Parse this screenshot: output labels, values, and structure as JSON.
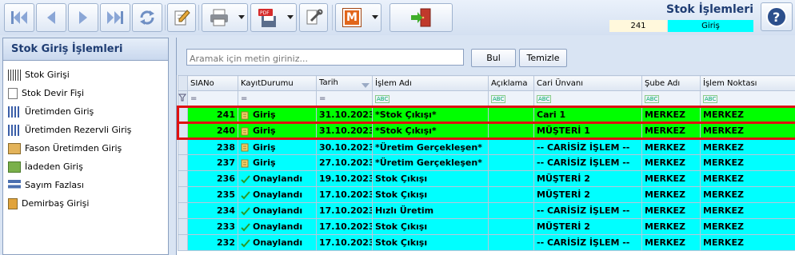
{
  "header": {
    "title": "Stok İşlemleri",
    "record_id": "241",
    "record_type": "Giriş"
  },
  "sidebar": {
    "title": "Stok Giriş İşlemleri",
    "items": [
      {
        "label": "Stok Girişi"
      },
      {
        "label": "Stok Devir Fişi"
      },
      {
        "label": "Üretimden Giriş"
      },
      {
        "label": "Üretimden Rezervli Giriş"
      },
      {
        "label": "Fason Üretimden Giriş"
      },
      {
        "label": "İadeden Giriş"
      },
      {
        "label": "Sayım Fazlası"
      },
      {
        "label": "Demirbaş Girişi"
      }
    ]
  },
  "search": {
    "placeholder": "Aramak için metin giriniz...",
    "find_label": "Bul",
    "clear_label": "Temizle"
  },
  "grid": {
    "columns": [
      "SIANo",
      "KayıtDurumu",
      "Tarih",
      "İşlem Adı",
      "Açıklama",
      "Cari Ünvanı",
      "Şube Adı",
      "İşlem Noktası"
    ],
    "filter_eq": "=",
    "filter_abc": "ABC",
    "rows": [
      {
        "no": "241",
        "status": "Giriş",
        "date": "31.10.2023",
        "op": "*Stok Çıkışı*",
        "desc": "",
        "cari": "Cari 1",
        "branch": "MERKEZ",
        "point": "MERKEZ"
      },
      {
        "no": "240",
        "status": "Giriş",
        "date": "31.10.2023",
        "op": "*Stok Çıkışı*",
        "desc": "",
        "cari": "MÜŞTERİ 1",
        "branch": "MERKEZ",
        "point": "MERKEZ"
      },
      {
        "no": "238",
        "status": "Giriş",
        "date": "30.10.2023",
        "op": "*Üretim Gerçekleşen*",
        "desc": "",
        "cari": "-- CARİSİZ İŞLEM --",
        "branch": "MERKEZ",
        "point": "MERKEZ"
      },
      {
        "no": "237",
        "status": "Giriş",
        "date": "27.10.2023",
        "op": "*Üretim Gerçekleşen*",
        "desc": "",
        "cari": "-- CARİSİZ İŞLEM --",
        "branch": "MERKEZ",
        "point": "MERKEZ"
      },
      {
        "no": "236",
        "status": "Onaylandı",
        "date": "19.10.2023",
        "op": "Stok Çıkışı",
        "desc": "",
        "cari": "MÜŞTERİ 2",
        "branch": "MERKEZ",
        "point": "MERKEZ"
      },
      {
        "no": "235",
        "status": "Onaylandı",
        "date": "17.10.2023",
        "op": "Stok Çıkışı",
        "desc": "",
        "cari": "MÜŞTERİ 2",
        "branch": "MERKEZ",
        "point": "MERKEZ"
      },
      {
        "no": "234",
        "status": "Onaylandı",
        "date": "17.10.2023",
        "op": "Hızlı Üretim",
        "desc": "",
        "cari": "-- CARİSİZ İŞLEM --",
        "branch": "MERKEZ",
        "point": "MERKEZ"
      },
      {
        "no": "233",
        "status": "Onaylandı",
        "date": "17.10.2023",
        "op": "Stok Çıkışı",
        "desc": "",
        "cari": "MÜŞTERİ 2",
        "branch": "MERKEZ",
        "point": "MERKEZ"
      },
      {
        "no": "232",
        "status": "Onaylandı",
        "date": "17.10.2023",
        "op": "Stok Çıkışı",
        "desc": "",
        "cari": "-- CARİSİZ İŞLEM --",
        "branch": "MERKEZ",
        "point": "MERKEZ"
      }
    ]
  },
  "colors": {
    "selected_row": "#00ff00",
    "row": "#00ffff",
    "selection_border": "#e01010"
  },
  "icons": {
    "first": "first-record-icon",
    "prev": "previous-record-icon",
    "next": "next-record-icon",
    "last": "last-record-icon",
    "refresh": "refresh-icon",
    "edit": "edit-icon",
    "print": "print-icon",
    "pdf": "pdf-save-icon",
    "tools": "tools-icon",
    "m": "m-icon",
    "exit": "exit-icon",
    "help": "help-icon",
    "m_letter": "M",
    "pdf_text": "PDF"
  }
}
